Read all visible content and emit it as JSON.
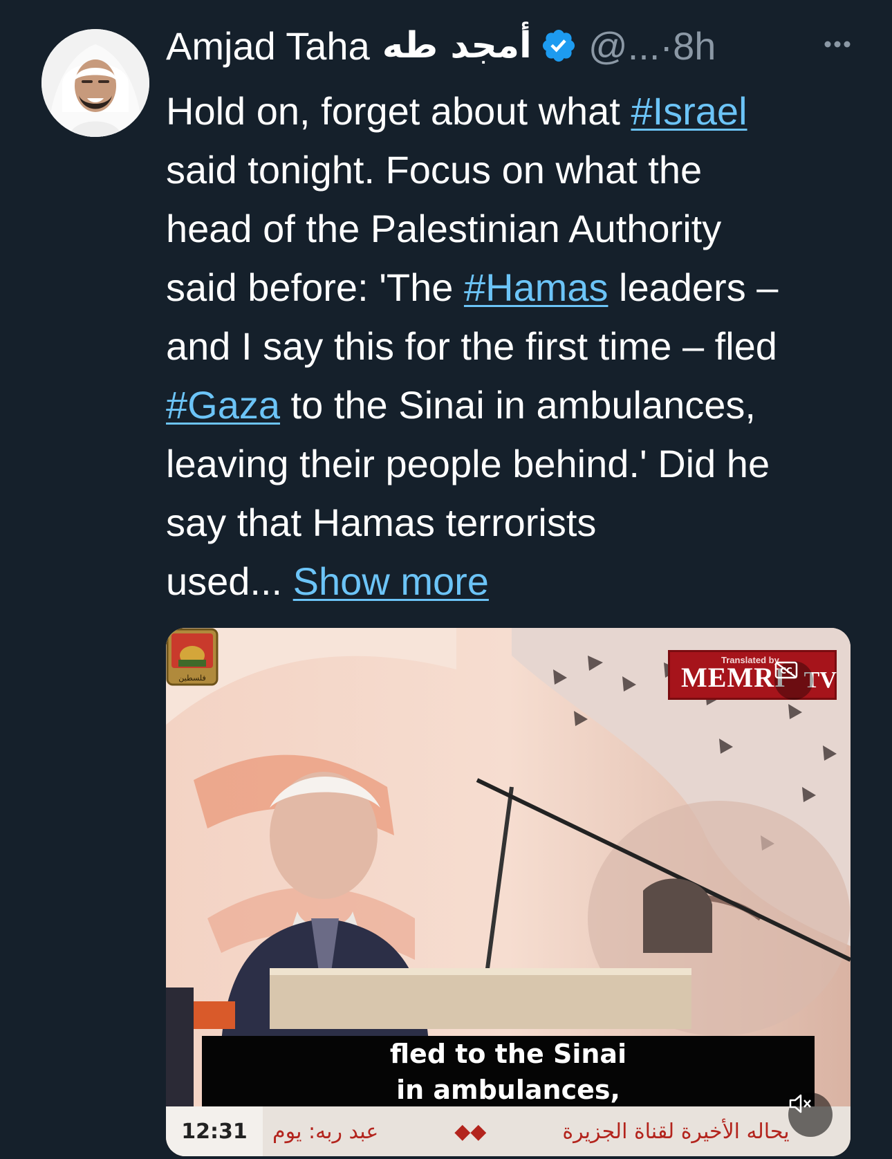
{
  "author": {
    "name": "Amjad Taha",
    "arabic_name": "أمجد طه",
    "handle": "@...",
    "separator": "·",
    "time": "8h"
  },
  "tweet": {
    "lines": [
      [
        "Hold on, forget about what ",
        {
          "link": "#Israel"
        }
      ],
      [
        "said tonight. Focus on what the"
      ],
      [
        "head of the Palestinian Authority"
      ],
      [
        "said before: 'The ",
        {
          "link": "#Hamas"
        },
        " leaders –"
      ],
      [
        "and I say this for the first time – fled"
      ],
      [
        {
          "link": "#Gaza"
        },
        " to the Sinai in ambulances,"
      ],
      [
        "leaving their people behind.' Did he"
      ],
      [
        "say that Hamas terrorists"
      ],
      [
        "used... ",
        {
          "link": "Show more"
        }
      ]
    ]
  },
  "media": {
    "badge_top": "Translated by",
    "badge_main": "MEMRI",
    "badge_suffix": "TV",
    "caption_line1": "fled to the Sinai",
    "caption_line2": "in ambulances,",
    "ticker_time": "12:31",
    "ticker_text1": "عبد ربه: يوم",
    "ticker_sep": "◆◆",
    "ticker_text2": "يحاله الأخيرة لقناة الجزيرة",
    "logo_text": "فلسطين"
  },
  "icons": {
    "verified": "verified-badge-icon",
    "more": "more-options-icon",
    "cc": "closed-captions-icon",
    "mute": "muted-speaker-icon"
  },
  "colors": {
    "background": "#15202b",
    "link": "#6cc4f7",
    "secondary_text": "#8b98a5",
    "verified": "#1d9bf0"
  }
}
